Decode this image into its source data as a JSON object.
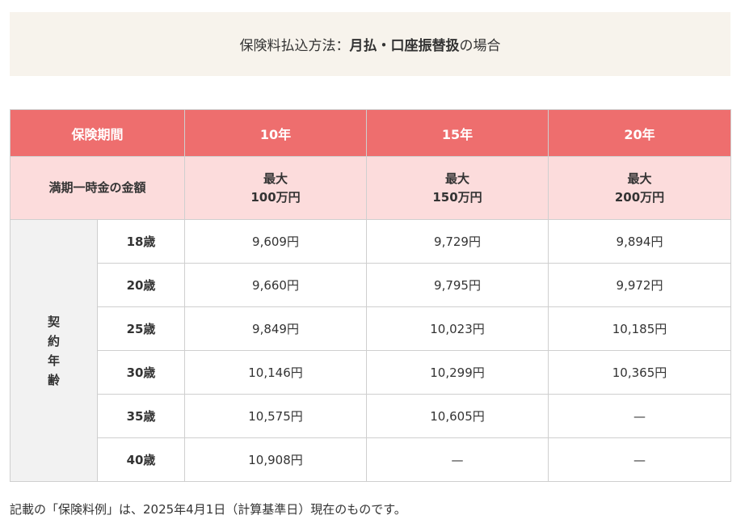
{
  "header": {
    "prefix": "保険料払込方法：",
    "emphasis": "月払・口座振替扱",
    "suffix": "の場合"
  },
  "table": {
    "period_label": "保険期間",
    "periods": [
      "10年",
      "15年",
      "20年"
    ],
    "maturity_label": "満期一時金の金額",
    "maturity_amounts": [
      {
        "line1": "最大",
        "line2": "100万円"
      },
      {
        "line1": "最大",
        "line2": "150万円"
      },
      {
        "line1": "最大",
        "line2": "200万円"
      }
    ],
    "age_group_chars": [
      "契",
      "約",
      "年",
      "齢"
    ],
    "rows": [
      {
        "age": "18歳",
        "values": [
          "9,609円",
          "9,729円",
          "9,894円"
        ]
      },
      {
        "age": "20歳",
        "values": [
          "9,660円",
          "9,795円",
          "9,972円"
        ]
      },
      {
        "age": "25歳",
        "values": [
          "9,849円",
          "10,023円",
          "10,185円"
        ]
      },
      {
        "age": "30歳",
        "values": [
          "10,146円",
          "10,299円",
          "10,365円"
        ]
      },
      {
        "age": "35歳",
        "values": [
          "10,575円",
          "10,605円",
          "—"
        ]
      },
      {
        "age": "40歳",
        "values": [
          "10,908円",
          "—",
          "—"
        ]
      }
    ]
  },
  "footnote": "記載の「保険料例」は、2025年4月1日（計算基準日）現在のものです。",
  "colors": {
    "header_bg": "#f7f3ec",
    "table_head_bg": "#ee6e6e",
    "table_sub_bg": "#fcdcdc",
    "age_group_bg": "#f2f2f2"
  }
}
